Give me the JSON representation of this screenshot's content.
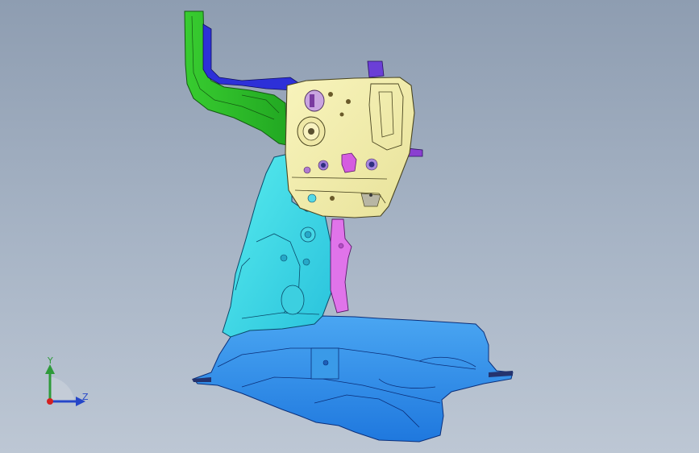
{
  "viewport": {
    "background_top": "#8e9db1",
    "background_bottom": "#bdc7d4"
  },
  "model": {
    "part_colors": {
      "bracket_green": "#2fbf2a",
      "panel_cyan": "#3fe0e6",
      "panel_blue": "#2f8de8",
      "plate_yellow": "#f2eea8",
      "clip_magenta": "#e070e8",
      "flange_darkblue": "#2d2fd8"
    }
  },
  "triad": {
    "y_label": "Y",
    "z_label": "Z",
    "y_color": "#2e9a3a",
    "z_color": "#2546c8",
    "x_color": "#d42020"
  }
}
